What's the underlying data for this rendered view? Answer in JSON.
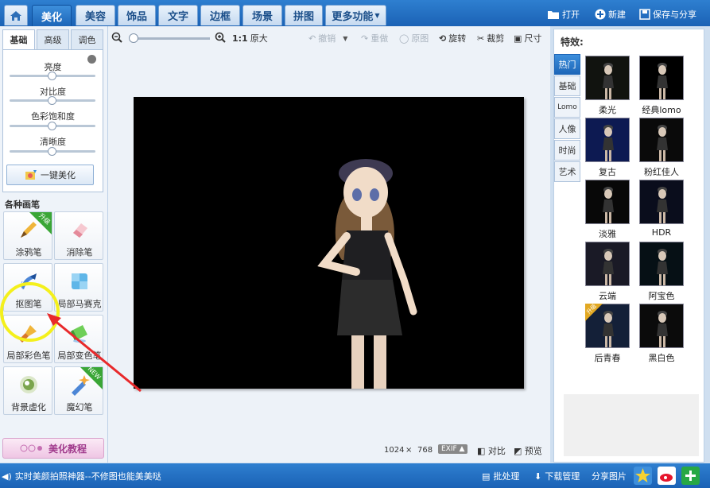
{
  "top_tabs": [
    "美化",
    "美容",
    "饰品",
    "文字",
    "边框",
    "场景",
    "拼图",
    "更多功能"
  ],
  "top_actions": {
    "open": "打开",
    "new": "新建",
    "save_share": "保存与分享"
  },
  "left_tabs": [
    "基础",
    "高级",
    "调色"
  ],
  "sliders": [
    {
      "label": "亮度",
      "level": 0.5
    },
    {
      "label": "对比度",
      "level": 0.5
    },
    {
      "label": "色彩饱和度",
      "level": 0.5
    },
    {
      "label": "清晰度",
      "level": 0.5
    }
  ],
  "one_key_button": "一键美化",
  "brushes_title": "各种画笔",
  "brushes": [
    {
      "label": "涂鸦笔",
      "badge": "升级"
    },
    {
      "label": "消除笔",
      "badge": ""
    },
    {
      "label": "抠图笔",
      "badge": ""
    },
    {
      "label": "局部马赛克",
      "badge": ""
    },
    {
      "label": "局部彩色笔",
      "badge": ""
    },
    {
      "label": "局部变色笔",
      "badge": ""
    },
    {
      "label": "背景虚化",
      "badge": ""
    },
    {
      "label": "魔幻笔",
      "badge": "NEW"
    }
  ],
  "tutorial_button": "美化教程",
  "canvas_toolbar": {
    "ratio_label": "1:1",
    "original_size": "原大",
    "undo": "撤销",
    "redo": "重做",
    "original": "原图",
    "rotate": "旋转",
    "crop": "裁剪",
    "size": "尺寸"
  },
  "image_size": {
    "width": "1024",
    "times": "×",
    "height": "768"
  },
  "exif": "EXIF",
  "compare": "对比",
  "preview": "预览",
  "effects_title": "特效:",
  "effect_tabs": [
    "热门",
    "基础",
    "Lomo",
    "人像",
    "时尚",
    "艺术"
  ],
  "effects": [
    {
      "label": "柔光",
      "tint": "#11130f"
    },
    {
      "label": "经典lomo",
      "tint": "#000000"
    },
    {
      "label": "复古",
      "tint": "#0d1a52"
    },
    {
      "label": "粉红佳人",
      "tint": "#0a0a0a"
    },
    {
      "label": "淡雅",
      "tint": "#080808"
    },
    {
      "label": "HDR",
      "tint": "#0a0d1c"
    },
    {
      "label": "云端",
      "tint": "#1a1a26"
    },
    {
      "label": "阿宝色",
      "tint": "#061015"
    },
    {
      "label": "后青春",
      "tint": "#142038",
      "badge": "升级"
    },
    {
      "label": "黑白色",
      "tint": "#0b0b0b"
    }
  ],
  "bottom": {
    "tip": "实时美颜拍照神器--不修图也能美美哒",
    "batch": "批处理",
    "download": "下载管理",
    "share": "分享图片"
  },
  "colors": {
    "accent": "#1d66b8",
    "highlight": "#f4f01c",
    "arrow": "#e8292b"
  }
}
